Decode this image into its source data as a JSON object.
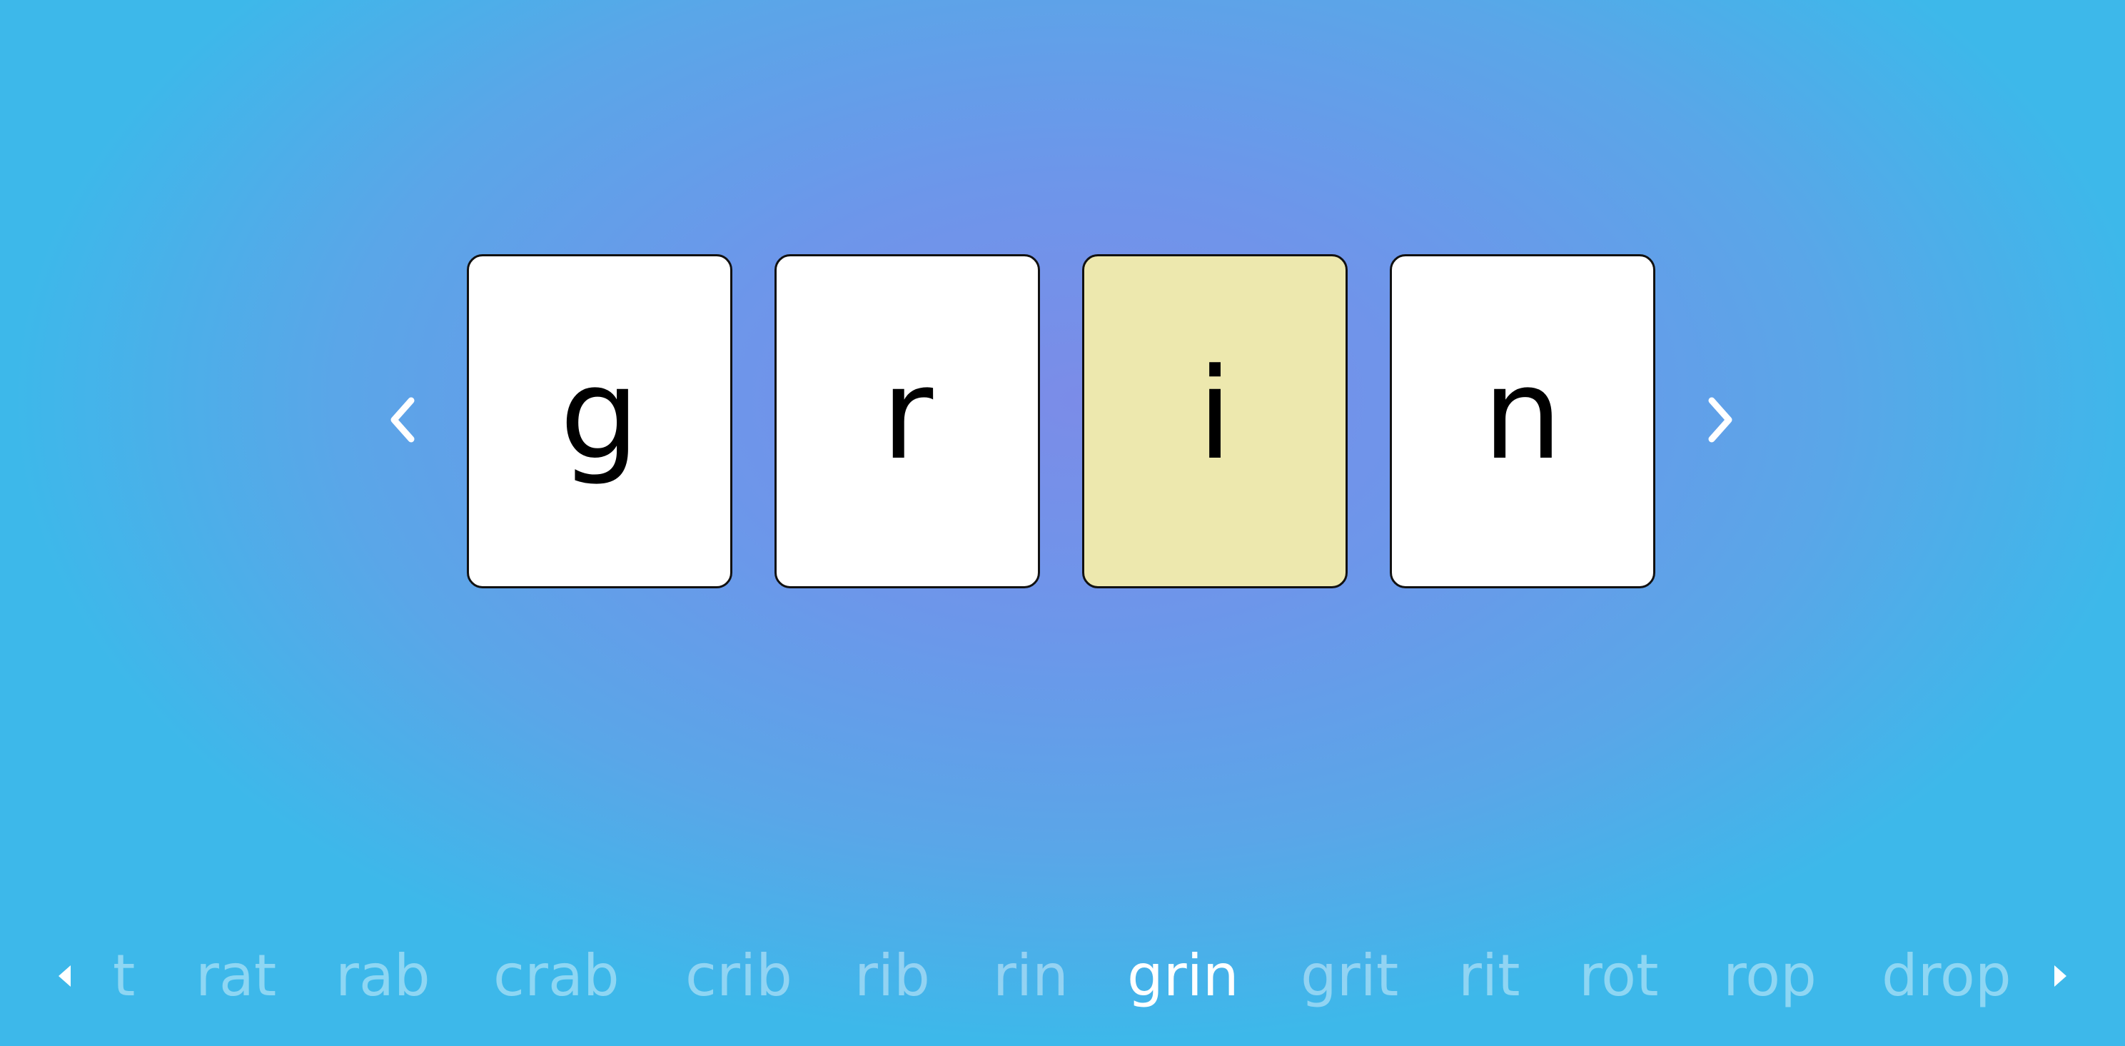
{
  "puzzle": {
    "letters": [
      "g",
      "r",
      "i",
      "n"
    ],
    "highlighted_index": 2
  },
  "navigation": {
    "prev_icon": "chevron-left-icon",
    "next_icon": "chevron-right-icon"
  },
  "history": {
    "words": [
      "t",
      "rat",
      "rab",
      "crab",
      "crib",
      "rib",
      "rin",
      "grin",
      "grit",
      "rit",
      "rot",
      "rop",
      "drop"
    ],
    "current_index": 7,
    "left_icon": "caret-left-icon",
    "right_icon": "caret-right-icon"
  },
  "colors": {
    "tile": "#ffffff",
    "tile_highlight": "#ede8ae",
    "word_inactive": "rgba(255,255,255,0.42)",
    "word_active": "#ffffff"
  }
}
